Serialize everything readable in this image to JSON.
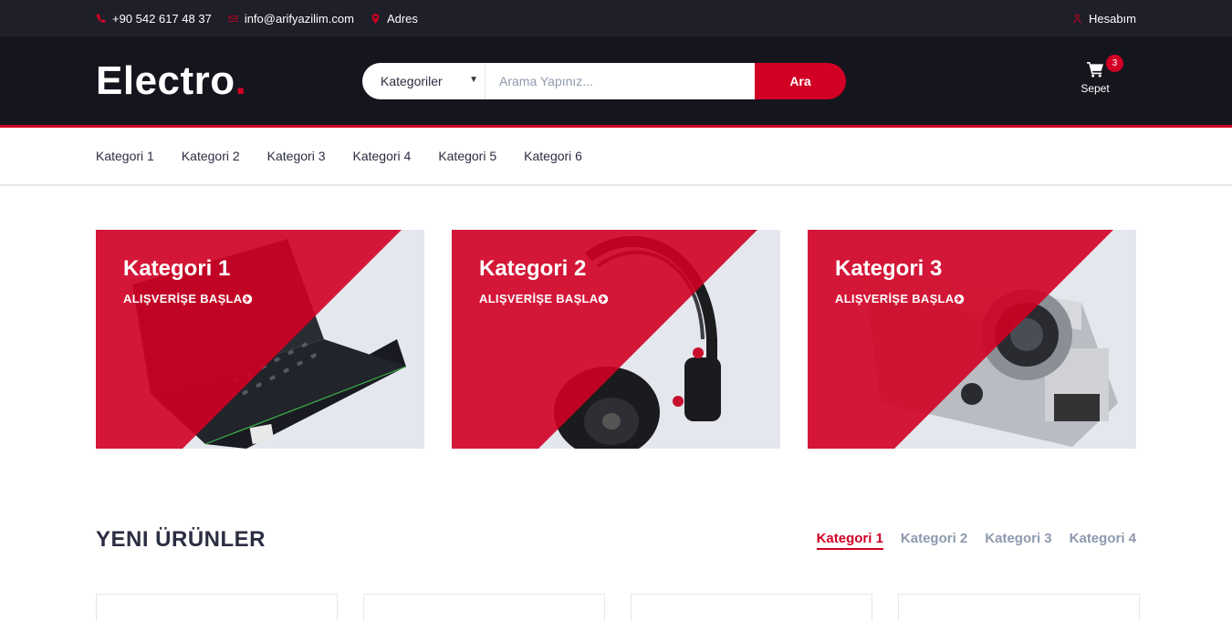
{
  "topbar": {
    "phone": "+90 542 617 48 37",
    "email": "info@arifyazilim.com",
    "address": "Adres",
    "account": "Hesabım"
  },
  "header": {
    "logo_text": "Electro",
    "logo_dot": ".",
    "select_label": "Kategoriler",
    "search_placeholder": "Arama Yapınız...",
    "search_button": "Ara",
    "cart_label": "Sepet",
    "cart_qty": "3"
  },
  "nav": {
    "items": [
      "Kategori 1",
      "Kategori 2",
      "Kategori 3",
      "Kategori 4",
      "Kategori 5",
      "Kategori 6"
    ]
  },
  "cards": [
    {
      "title": "Kategori 1",
      "cta": "ALIŞVERİŞE BAŞLA",
      "image": "laptop"
    },
    {
      "title": "Kategori 2",
      "cta": "ALIŞVERİŞE BAŞLA",
      "image": "headphones"
    },
    {
      "title": "Kategori 3",
      "cta": "ALIŞVERİŞE BAŞLA",
      "image": "camera"
    }
  ],
  "section": {
    "title": "YENI ÜRÜNLER",
    "tabs": [
      "Kategori 1",
      "Kategori 2",
      "Kategori 3",
      "Kategori 4"
    ],
    "active_tab": "Kategori 1"
  },
  "colors": {
    "accent": "#D10024",
    "topbar_bg": "#1E1F29",
    "header_bg": "#15161D"
  }
}
